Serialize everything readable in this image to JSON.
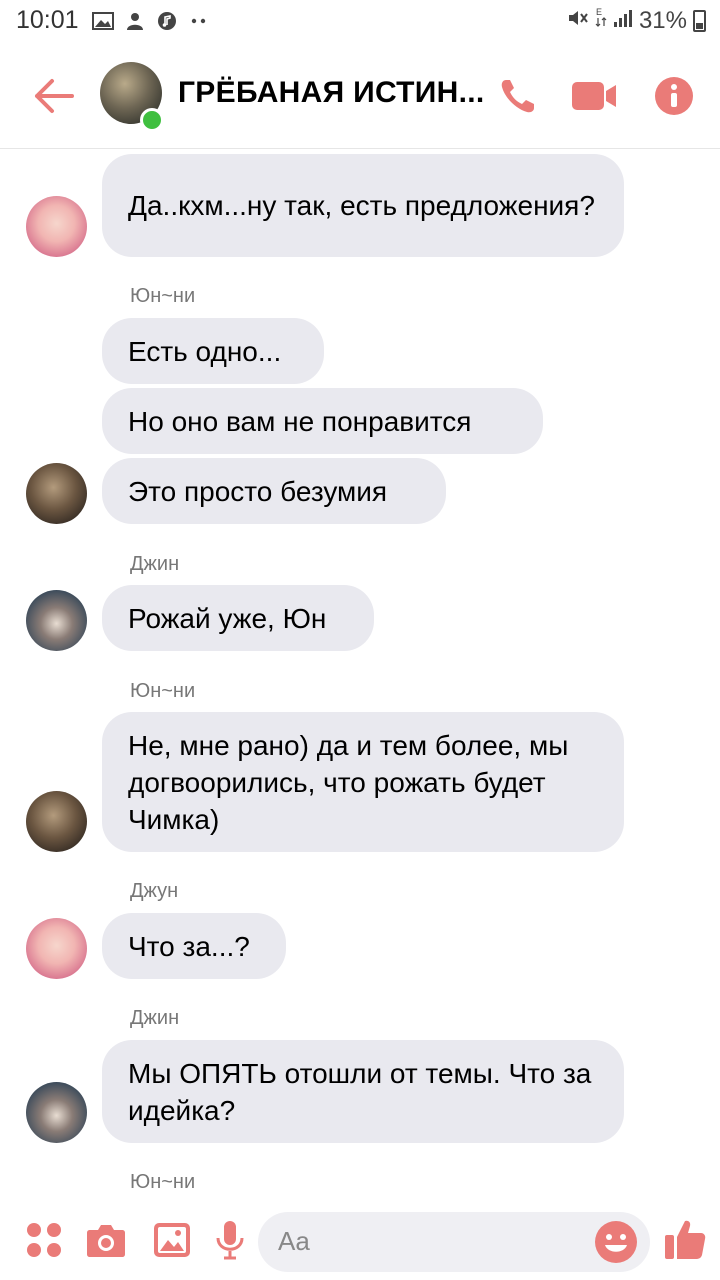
{
  "status_bar": {
    "time": "10:01",
    "battery": "31%",
    "icons_left": [
      "image-icon",
      "user-badge-icon",
      "music-icon",
      "more-dots-icon"
    ],
    "icons_right": [
      "mute-icon",
      "data-icon",
      "signal-icon",
      "battery-icon"
    ]
  },
  "header": {
    "title": "ГРЁБАНАЯ ИСТИН...",
    "online": true,
    "accent_color": "#ea7b78"
  },
  "messages": [
    {
      "sender": "",
      "avatar": "pink",
      "bubbles": [
        "Да..кхм...ну так, есть предложения?"
      ]
    },
    {
      "sender": "Юн~ни",
      "avatar": "brown",
      "bubbles": [
        "Есть одно...",
        "Но оно вам не понравится",
        "Это просто безумия"
      ]
    },
    {
      "sender": "Джин",
      "avatar": "dark",
      "bubbles": [
        "Рожай уже, Юн"
      ]
    },
    {
      "sender": "Юн~ни",
      "avatar": "brown",
      "bubbles": [
        "Не, мне рано) да и тем более, мы догвоорились, что рожать будет Чимка)"
      ]
    },
    {
      "sender": "Джун",
      "avatar": "pink",
      "bubbles": [
        "Что за...?"
      ]
    },
    {
      "sender": "Джин",
      "avatar": "dark",
      "bubbles": [
        "Мы ОПЯТЬ отошли от темы. Что за идейка?"
      ]
    },
    {
      "sender": "Юн~ни",
      "avatar": "",
      "bubbles": []
    }
  ],
  "composer": {
    "placeholder": "Aa"
  }
}
